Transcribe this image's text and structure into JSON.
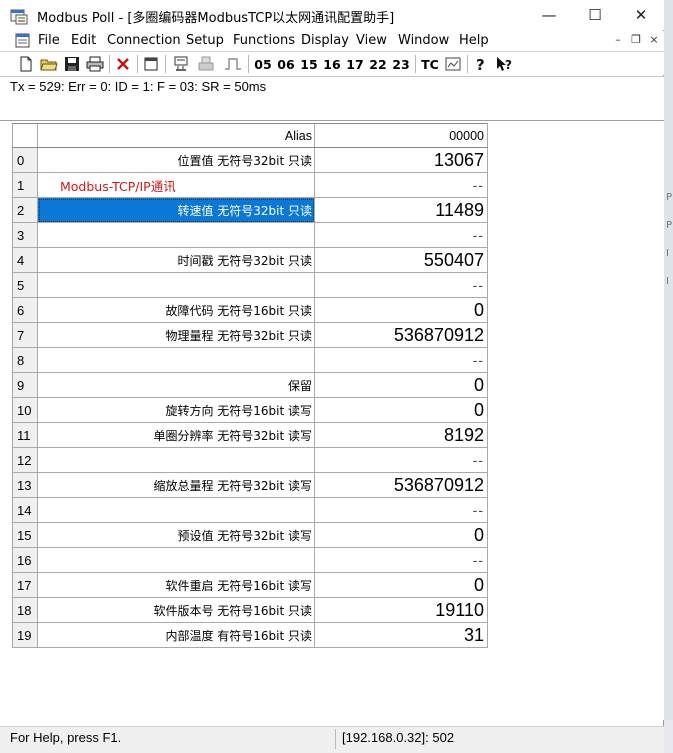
{
  "window": {
    "title": "Modbus Poll - [多圈编码器ModbusTCP以太网通讯配置助手]",
    "minimize": "—",
    "maximize": "☐",
    "close": "✕"
  },
  "menu": {
    "items": [
      "File",
      "Edit",
      "Connection",
      "Setup",
      "Functions",
      "Display",
      "View",
      "Window",
      "Help"
    ],
    "mdi_min": "–",
    "mdi_restore": "❐",
    "mdi_close": "×"
  },
  "toolbar": {
    "function_codes": [
      "05",
      "06",
      "15",
      "16",
      "17",
      "22",
      "23"
    ],
    "tc_label": "TC"
  },
  "status_line": "Tx = 529: Err = 0: ID = 1: F = 03: SR = 50ms",
  "grid": {
    "alias_header": "Alias",
    "address_header": "00000",
    "rows": [
      {
        "n": "0",
        "alias": "位置值 无符号32bit 只读",
        "value": "13067"
      },
      {
        "n": "1",
        "alias": "Modbus-TCP/IP通讯",
        "value": "--"
      },
      {
        "n": "2",
        "alias": "转速值 无符号32bit 只读",
        "value": "11489"
      },
      {
        "n": "3",
        "alias": "",
        "value": "--"
      },
      {
        "n": "4",
        "alias": "时间戳 无符号32bit 只读",
        "value": "550407"
      },
      {
        "n": "5",
        "alias": "",
        "value": "--"
      },
      {
        "n": "6",
        "alias": "故障代码 无符号16bit 只读",
        "value": "0"
      },
      {
        "n": "7",
        "alias": "物理量程 无符号32bit 只读",
        "value": "536870912"
      },
      {
        "n": "8",
        "alias": "",
        "value": "--"
      },
      {
        "n": "9",
        "alias": "保留",
        "value": "0"
      },
      {
        "n": "10",
        "alias": "旋转方向 无符号16bit 读写",
        "value": "0"
      },
      {
        "n": "11",
        "alias": "单圈分辨率 无符号32bit 读写",
        "value": "8192"
      },
      {
        "n": "12",
        "alias": "",
        "value": "--"
      },
      {
        "n": "13",
        "alias": "缩放总量程 无符号32bit 读写",
        "value": "536870912"
      },
      {
        "n": "14",
        "alias": "",
        "value": "--"
      },
      {
        "n": "15",
        "alias": "预设值 无符号32bit 读写",
        "value": "0"
      },
      {
        "n": "16",
        "alias": "",
        "value": "--"
      },
      {
        "n": "17",
        "alias": "软件重启 无符号16bit 读写",
        "value": "0"
      },
      {
        "n": "18",
        "alias": "软件版本号 无符号16bit 只读",
        "value": "19110"
      },
      {
        "n": "19",
        "alias": "内部温度 有符号16bit 只读",
        "value": "31"
      }
    ]
  },
  "statusbar": {
    "help": "For Help, press F1.",
    "connection": "[192.168.0.32]: 502"
  },
  "colors": {
    "selection": "#0b78d8",
    "red_label": "#d01818",
    "row_header_bg": "#f0f0f0"
  }
}
